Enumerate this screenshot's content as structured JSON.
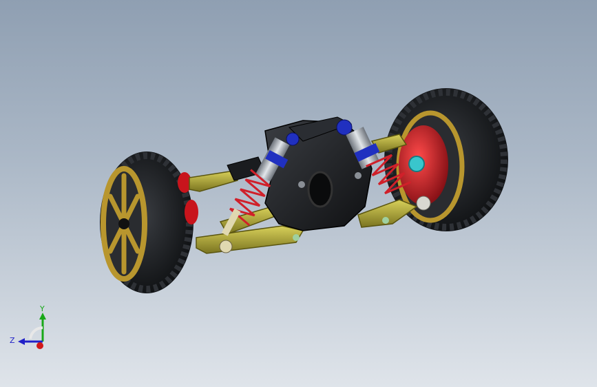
{
  "triad": {
    "y_label": "Y",
    "z_label": "Z",
    "colors": {
      "x": "#d01818",
      "y": "#18a818",
      "z": "#2020c8"
    }
  },
  "colors": {
    "tire": "#15171a",
    "tread": "#2e3136",
    "rim": "#b8962e",
    "hub": "#b3131b",
    "arm": "#a8a232",
    "chassis": "#1d1f22",
    "spring": "#d0202a",
    "shock_cap": "#2030c0",
    "shock_body": "#9aa0a8",
    "bearing": "#39c6cc"
  }
}
